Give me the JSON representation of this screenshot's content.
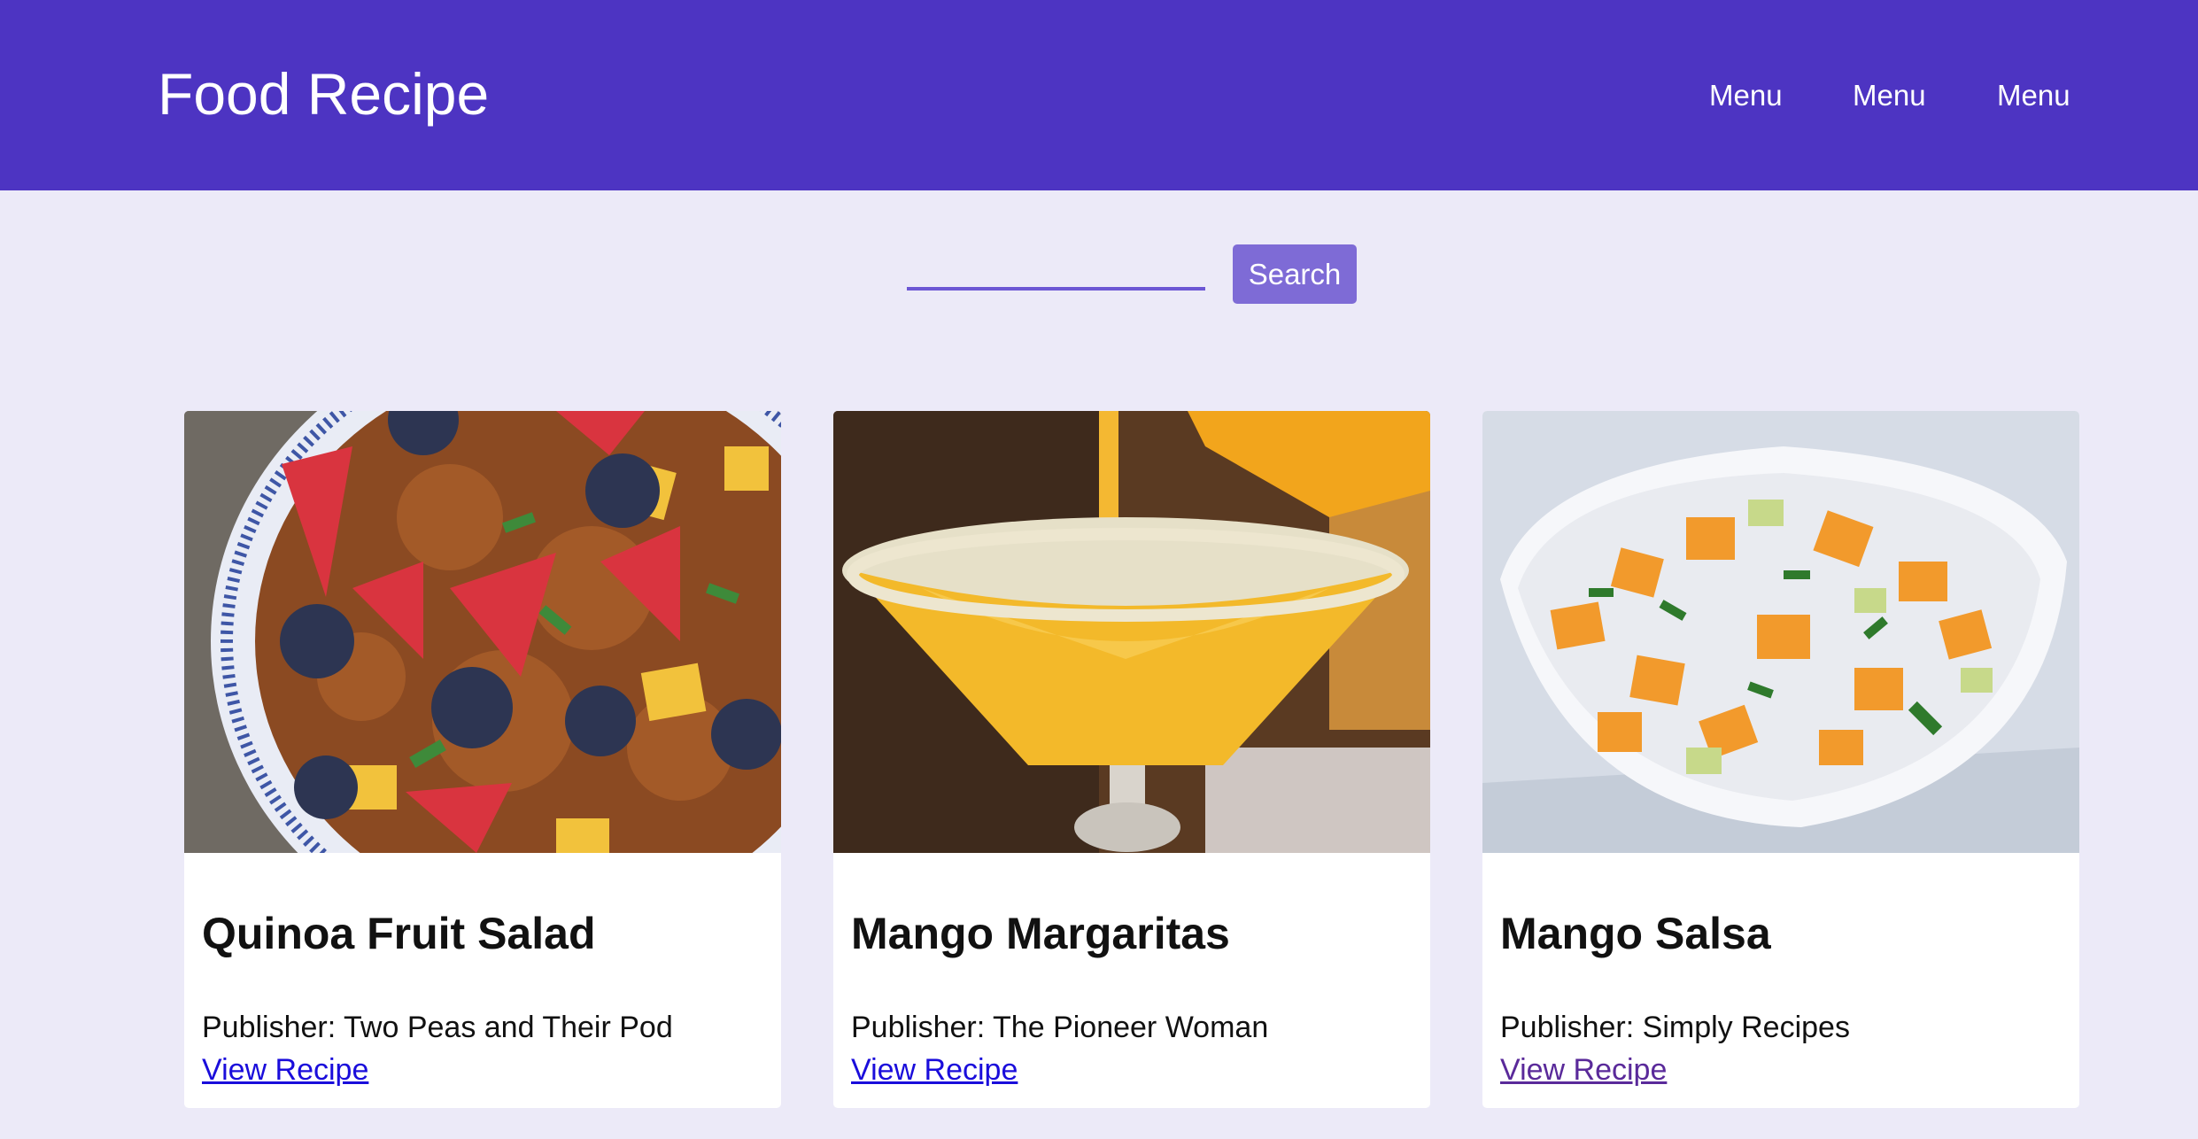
{
  "header": {
    "brand": "Food Recipe",
    "nav": [
      "Menu",
      "Menu",
      "Menu"
    ]
  },
  "search": {
    "value": "",
    "placeholder": "",
    "button_label": "Search"
  },
  "colors": {
    "header_bg": "#4D34C2",
    "page_bg": "#ECEAF8",
    "search_button": "#7E6BD6",
    "link": "#1A0DDB",
    "link_visited": "#5A2A9A"
  },
  "recipes": [
    {
      "title": "Quinoa Fruit Salad",
      "publisher_label": "Publisher: ",
      "publisher": "Two Peas and Their Pod",
      "link_label": "View Recipe",
      "image": "quinoa-fruit-salad-photo"
    },
    {
      "title": "Mango Margaritas",
      "publisher_label": "Publisher: ",
      "publisher": "The Pioneer Woman",
      "link_label": "View Recipe",
      "image": "mango-margarita-photo"
    },
    {
      "title": "Mango Salsa",
      "publisher_label": "Publisher: ",
      "publisher": "Simply Recipes",
      "link_label": "View Recipe",
      "image": "mango-salsa-photo"
    }
  ]
}
